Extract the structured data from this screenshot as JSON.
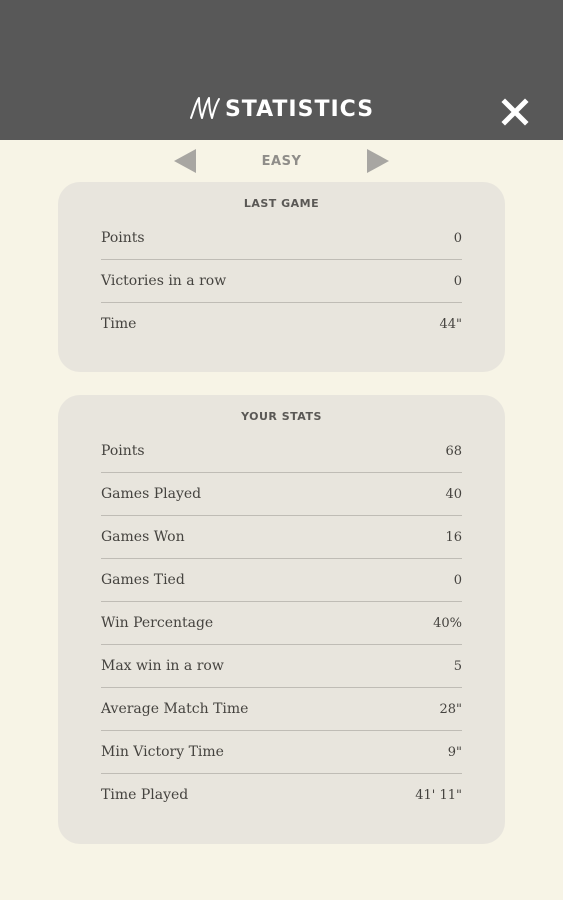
{
  "header": {
    "title": "STATISTICS",
    "close_icon": "close-icon",
    "background": "#585858"
  },
  "difficulty": {
    "label": "EASY",
    "prev_icon": "triangle-left-icon",
    "next_icon": "triangle-right-icon"
  },
  "last_game": {
    "title": "LAST GAME",
    "rows": [
      {
        "label": "Points",
        "value": "0"
      },
      {
        "label": "Victories in a row",
        "value": "0"
      },
      {
        "label": "Time",
        "value": "44\""
      }
    ]
  },
  "your_stats": {
    "title": "YOUR STATS",
    "rows": [
      {
        "label": "Points",
        "value": "68"
      },
      {
        "label": "Games Played",
        "value": "40"
      },
      {
        "label": "Games Won",
        "value": "16"
      },
      {
        "label": "Games Tied",
        "value": "0"
      },
      {
        "label": "Win Percentage",
        "value": "40%"
      },
      {
        "label": "Max win in a row",
        "value": "5"
      },
      {
        "label": "Average Match Time",
        "value": "28\""
      },
      {
        "label": "Min Victory Time",
        "value": "9\""
      },
      {
        "label": "Time Played",
        "value": "41' 11\""
      }
    ]
  },
  "colors": {
    "page_background": "#f7f4e6",
    "card_background": "#e8e5dd",
    "arrow": "#a8a6a2"
  }
}
